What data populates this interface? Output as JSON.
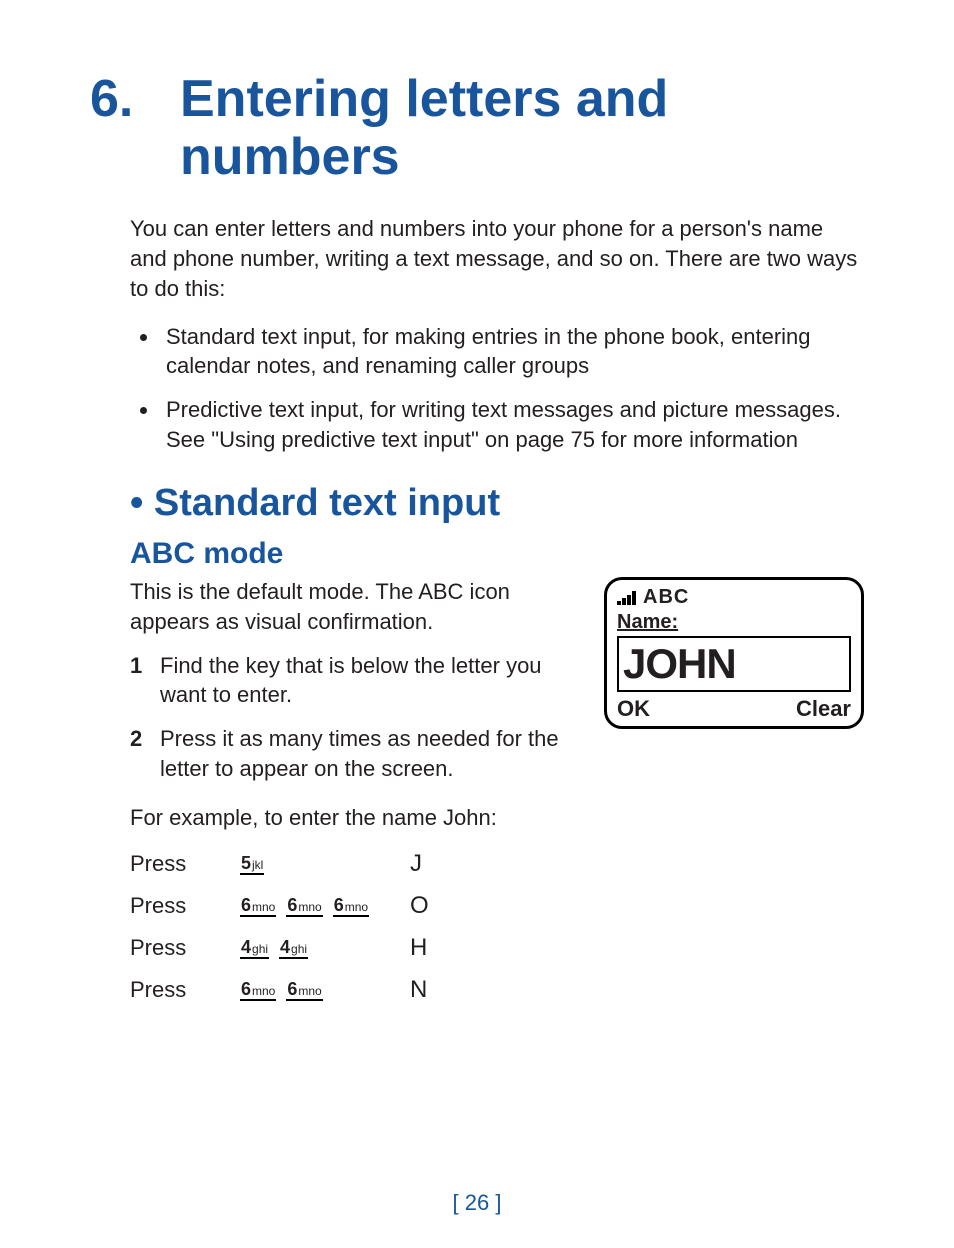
{
  "chapter": {
    "number": "6.",
    "title": "Entering letters and numbers"
  },
  "intro": "You can enter letters and numbers into your phone for a person's name and phone number, writing a text message, and so on. There are two ways to do this:",
  "bullets": [
    "Standard text input, for making entries in the phone book, entering calendar notes, and renaming caller groups",
    "Predictive text input, for writing text messages and picture messages. See \"Using predictive text input\" on page 75 for more information"
  ],
  "section": "• Standard text input",
  "subsection": "ABC mode",
  "abc_intro": "This is the default mode. The ABC icon appears as visual confirmation.",
  "steps": [
    {
      "n": "1",
      "t": "Find the key that is below the letter you want to enter."
    },
    {
      "n": "2",
      "t": "Press it as many times as needed for the letter to appear on the screen."
    }
  ],
  "example_lead": "For example, to enter the name John:",
  "press_label": "Press",
  "keys": {
    "5": {
      "num": "5",
      "letters": "jkl"
    },
    "6": {
      "num": "6",
      "letters": "mno"
    },
    "4": {
      "num": "4",
      "letters": "ghi"
    }
  },
  "press_rows": [
    {
      "seq": [
        "5"
      ],
      "result": "J"
    },
    {
      "seq": [
        "6",
        "6",
        "6"
      ],
      "result": "O"
    },
    {
      "seq": [
        "4",
        "4"
      ],
      "result": "H"
    },
    {
      "seq": [
        "6",
        "6"
      ],
      "result": "N"
    }
  ],
  "phone": {
    "indicator": "ABC",
    "field_label": "Name:",
    "entered": "JOHN",
    "left_soft": "OK",
    "right_soft": "Clear"
  },
  "page_number": "[ 26 ]"
}
